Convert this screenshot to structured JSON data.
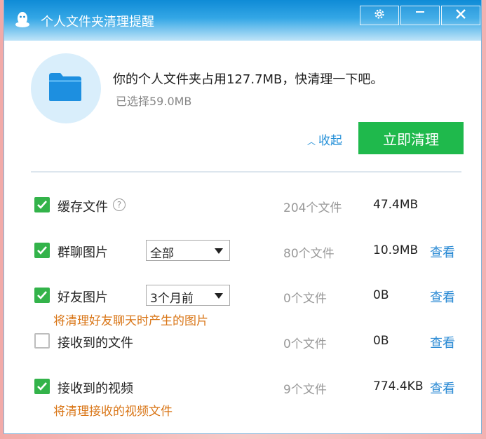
{
  "window": {
    "title": "个人文件夹清理提醒"
  },
  "summary": {
    "headline": "你的个人文件夹占用127.7MB，快清理一下吧。",
    "selected": "已选择59.0MB",
    "collapse_label": "收起",
    "clean_button": "立即清理"
  },
  "colors": {
    "accent": "#1fb94c",
    "link": "#2a8ad4",
    "note": "#d97516",
    "title_blue": "#0f8bd6"
  },
  "icons": [
    "qq-penguin-icon",
    "gear-icon",
    "minimize-icon",
    "close-icon",
    "folder-icon",
    "help-icon",
    "chevron-up-icon",
    "chevron-down-icon",
    "checkmark-icon"
  ],
  "items": [
    {
      "label": "缓存文件",
      "checked": true,
      "count": "204个文件",
      "size": "47.4MB"
    },
    {
      "label": "群聊图片",
      "checked": true,
      "filter": "全部",
      "count": "80个文件",
      "size": "10.9MB",
      "view": "查看"
    },
    {
      "label": "好友图片",
      "checked": true,
      "filter": "3个月前",
      "count": "0个文件",
      "size": "0B",
      "view": "查看",
      "note": "将清理好友聊天时产生的图片"
    },
    {
      "label": "接收到的文件",
      "checked": false,
      "count": "0个文件",
      "size": "0B",
      "view": "查看"
    },
    {
      "label": "接收到的视频",
      "checked": true,
      "count": "9个文件",
      "size": "774.4KB",
      "view": "查看",
      "note": "将清理接收的视频文件"
    }
  ]
}
